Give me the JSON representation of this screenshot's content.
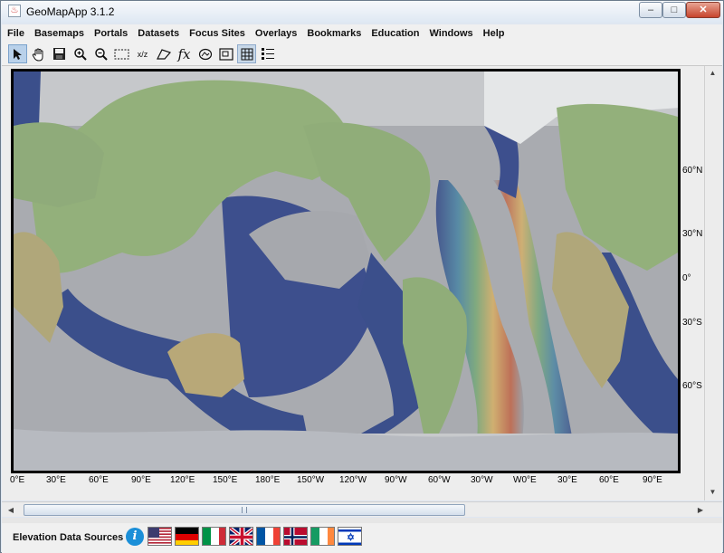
{
  "window": {
    "title": "GeoMapApp 3.1.2",
    "controls": {
      "minimize": "–",
      "maximize": "□",
      "close": "✕"
    }
  },
  "menubar": [
    "File",
    "Basemaps",
    "Portals",
    "Datasets",
    "Focus Sites",
    "Overlays",
    "Bookmarks",
    "Education",
    "Windows",
    "Help"
  ],
  "toolbar": {
    "icons": [
      "select-arrow-icon",
      "pan-hand-icon",
      "save-disk-icon",
      "zoom-in-icon",
      "zoom-out-icon",
      "rect-select-icon",
      "xyz-icon",
      "digitize-icon",
      "function-fx-icon",
      "profile-icon",
      "frame-icon",
      "grid-icon",
      "layers-list-icon"
    ],
    "fx_label": "fx",
    "xyz_label": "x/z"
  },
  "map": {
    "lat_labels": [
      "60°N",
      "30°N",
      "0°",
      "30°S",
      "60°S"
    ],
    "lon_labels": [
      "0°E",
      "30°E",
      "60°E",
      "90°E",
      "120°E",
      "150°E",
      "180°E",
      "150°W",
      "120°W",
      "90°W",
      "60°W",
      "30°W",
      "W0°E",
      "30°E",
      "60°E",
      "90°E"
    ]
  },
  "status": {
    "elevation_label": "Elevation Data Sources",
    "info_label": "i",
    "flags": [
      "usa-flag-icon",
      "germany-flag-icon",
      "italy-flag-icon",
      "uk-flag-icon",
      "france-flag-icon",
      "norway-flag-icon",
      "ireland-flag-icon",
      "israel-flag-icon"
    ]
  },
  "colors": {
    "ocean_deep": "#3c4f8a",
    "ocean_mid": "#4a7aa0",
    "ridge_red": "#c06a4e",
    "ridge_yellow": "#d4b06a",
    "ridge_green": "#6fa07a",
    "land": "#8fae7a",
    "ice": "#c8c8c8"
  }
}
